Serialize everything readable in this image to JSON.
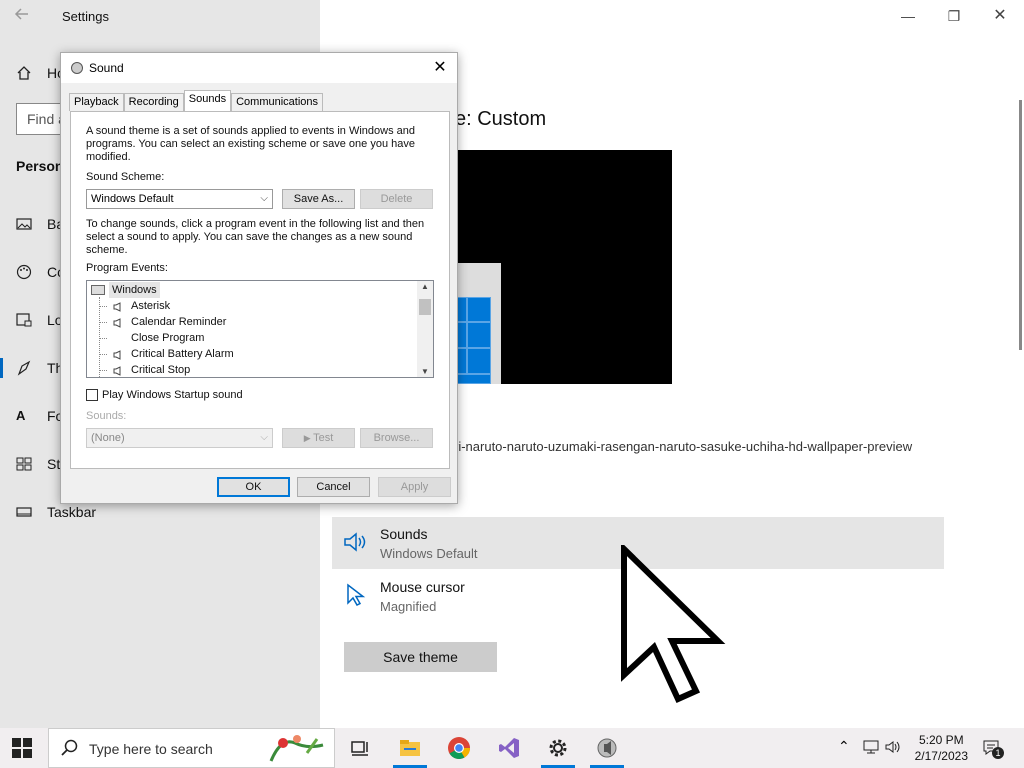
{
  "settings": {
    "window_title": "Settings",
    "nav_home": "Ho",
    "search_placeholder": "Find a",
    "section": "Person",
    "nav": [
      {
        "label": "Ba",
        "icon": "image-icon"
      },
      {
        "label": "Co",
        "icon": "palette-icon"
      },
      {
        "label": "Lo",
        "icon": "lock-screen-icon"
      },
      {
        "label": "Th",
        "icon": "themes-icon"
      },
      {
        "label": "Fo",
        "icon": "fonts-icon"
      },
      {
        "label": "St",
        "icon": "start-icon"
      },
      {
        "label": "Taskbar",
        "icon": "taskbar-icon"
      }
    ],
    "heading": "e: Custom",
    "background_name": "ri-naruto-naruto-uzumaki-rasengan-naruto-sasuke-uchiha-hd-wallpaper-preview",
    "rows": [
      {
        "title": "Sounds",
        "subtitle": "Windows Default",
        "icon": "speaker-icon"
      },
      {
        "title": "Mouse cursor",
        "subtitle": "Magnified",
        "icon": "mouse-pointer-icon"
      }
    ],
    "save_theme": "Save theme"
  },
  "dialog": {
    "title": "Sound",
    "tabs": [
      "Playback",
      "Recording",
      "Sounds",
      "Communications"
    ],
    "active_tab": "Sounds",
    "intro": "A sound theme is a set of sounds applied to events in Windows and programs.  You can select an existing scheme or save one you have modified.",
    "scheme_label": "Sound Scheme:",
    "scheme_value": "Windows Default",
    "save_as": "Save As...",
    "delete": "Delete",
    "instructions": "To change sounds, click a program event in the following list and then select a sound to apply.  You can save the changes as a new sound scheme.",
    "events_label": "Program Events:",
    "events": [
      {
        "label": "Windows",
        "root": true
      },
      {
        "label": "Asterisk",
        "sound": true
      },
      {
        "label": "Calendar Reminder",
        "sound": true
      },
      {
        "label": "Close Program",
        "sound": false
      },
      {
        "label": "Critical Battery Alarm",
        "sound": true
      },
      {
        "label": "Critical Stop",
        "sound": true
      }
    ],
    "startup_label": "Play Windows Startup sound",
    "sounds_label": "Sounds:",
    "sounds_value": "(None)",
    "test": "Test",
    "browse": "Browse...",
    "ok": "OK",
    "cancel": "Cancel",
    "apply": "Apply"
  },
  "taskbar": {
    "search_placeholder": "Type here to search",
    "time": "5:20 PM",
    "date": "2/17/2023",
    "notification_count": "1",
    "accent": "#0078d7"
  }
}
